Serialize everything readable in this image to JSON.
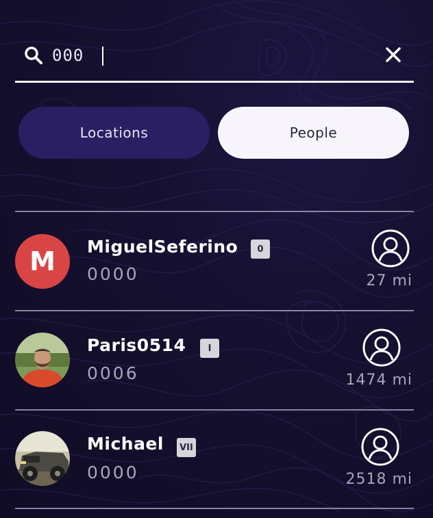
{
  "search": {
    "value": "000",
    "icon": "search-icon",
    "clear_icon": "close-icon"
  },
  "tabs": [
    {
      "label": "Locations",
      "selected": false
    },
    {
      "label": "People",
      "selected": true
    }
  ],
  "users": [
    {
      "name": "MiguelSeferino",
      "badge": "0",
      "sub": "0000",
      "distance": "27 mi",
      "avatar_letter": "M",
      "avatar_type": "letter"
    },
    {
      "name": "Paris0514",
      "badge": "I",
      "sub": "0006",
      "distance": "1474 mi",
      "avatar_type": "photo"
    },
    {
      "name": "Michael",
      "badge": "VII",
      "sub": "0000",
      "distance": "2518 mi",
      "avatar_type": "photo"
    }
  ],
  "colors": {
    "background": "#130f2b",
    "tab_inactive": "#2a1f63",
    "tab_active": "#f7f5fb",
    "avatar_letter_bg": "#d94545",
    "muted_text": "#a9a6bc"
  }
}
